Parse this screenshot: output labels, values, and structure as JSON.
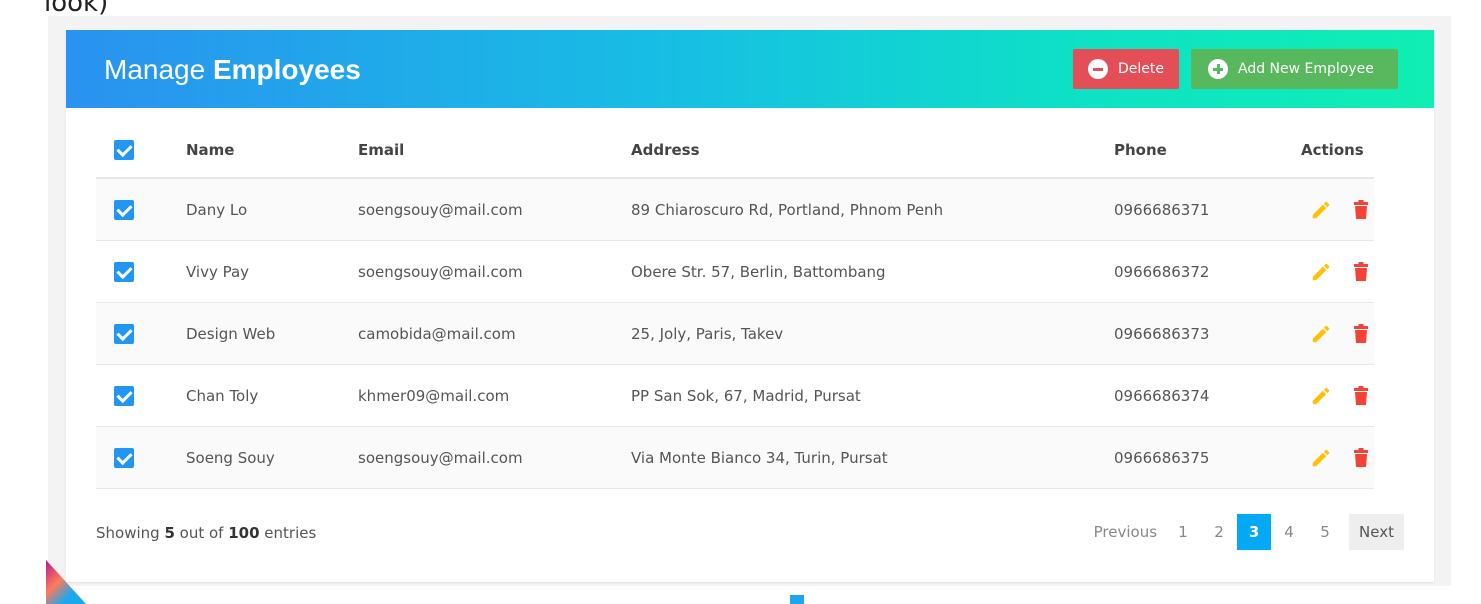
{
  "top_crop_text": "look)",
  "header": {
    "title_light": "Manage ",
    "title_bold": "Employees",
    "delete_label": "Delete",
    "add_label": "Add New Employee"
  },
  "table": {
    "columns": {
      "name": "Name",
      "email": "Email",
      "address": "Address",
      "phone": "Phone",
      "actions": "Actions"
    },
    "rows": [
      {
        "name": "Dany Lo",
        "email": "soengsouy@mail.com",
        "address": "89 Chiaroscuro Rd, Portland, Phnom Penh",
        "phone": "0966686371"
      },
      {
        "name": "Vivy Pay",
        "email": "soengsouy@mail.com",
        "address": "Obere Str. 57, Berlin, Battombang",
        "phone": "0966686372"
      },
      {
        "name": "Design Web",
        "email": "camobida@mail.com",
        "address": "25, Joly, Paris, Takev",
        "phone": "0966686373"
      },
      {
        "name": "Chan Toly",
        "email": "khmer09@mail.com",
        "address": "PP San Sok, 67, Madrid, Pursat",
        "phone": "0966686374"
      },
      {
        "name": "Soeng Souy",
        "email": "soengsouy@mail.com",
        "address": "Via Monte Bianco 34, Turin, Pursat",
        "phone": "0966686375"
      }
    ]
  },
  "footer": {
    "showing_prefix": "Showing ",
    "shown_count": "5",
    "showing_middle": " out of ",
    "total_count": "100",
    "showing_suffix": " entries"
  },
  "pagination": {
    "previous": "Previous",
    "pages": [
      "1",
      "2",
      "3",
      "4",
      "5"
    ],
    "active_page": "3",
    "next": "Next"
  },
  "colors": {
    "header_gradient_start": "#2a92f0",
    "header_gradient_end": "#10eeb3",
    "delete_button": "#e44e56",
    "add_button": "#58b85e",
    "checkbox": "#2196f3",
    "edit_icon": "#ffc107",
    "delete_icon": "#f44336",
    "active_page": "#03a9f4"
  },
  "icons": {
    "delete_button_icon": "minus-circle-icon",
    "add_button_icon": "plus-circle-icon",
    "edit": "pencil-icon",
    "delete": "trash-icon"
  }
}
